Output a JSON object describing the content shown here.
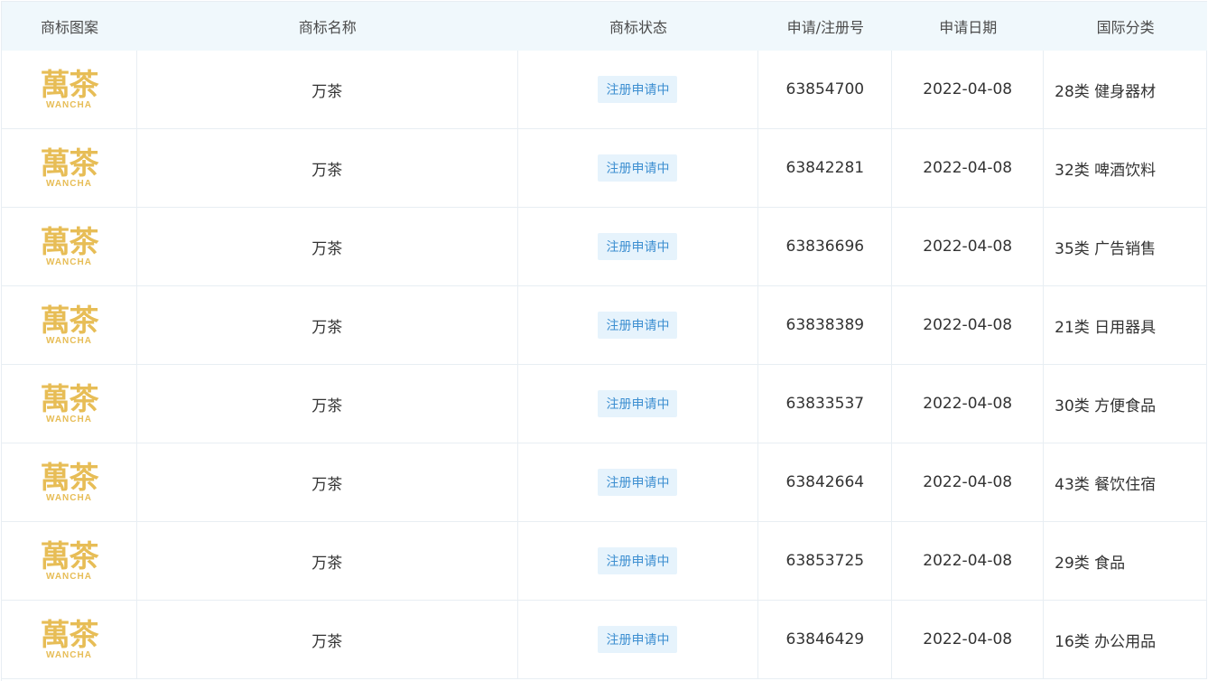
{
  "headers": {
    "logo": "商标图案",
    "name": "商标名称",
    "status": "商标状态",
    "regno": "申请/注册号",
    "date": "申请日期",
    "class": "国际分类"
  },
  "logo": {
    "main": "萬茶",
    "sub": "WANCHA",
    "color": "#e7bd56"
  },
  "colors": {
    "header_bg": "#f0f8fc",
    "badge_bg": "#e6f3fc",
    "badge_text": "#3d8fd1",
    "border": "#e8eef3"
  },
  "rows": [
    {
      "name": "万茶",
      "status": "注册申请中",
      "regno": "63854700",
      "date": "2022-04-08",
      "class": "28类 健身器材"
    },
    {
      "name": "万茶",
      "status": "注册申请中",
      "regno": "63842281",
      "date": "2022-04-08",
      "class": "32类 啤酒饮料"
    },
    {
      "name": "万茶",
      "status": "注册申请中",
      "regno": "63836696",
      "date": "2022-04-08",
      "class": "35类 广告销售"
    },
    {
      "name": "万茶",
      "status": "注册申请中",
      "regno": "63838389",
      "date": "2022-04-08",
      "class": "21类 日用器具"
    },
    {
      "name": "万茶",
      "status": "注册申请中",
      "regno": "63833537",
      "date": "2022-04-08",
      "class": "30类 方便食品"
    },
    {
      "name": "万茶",
      "status": "注册申请中",
      "regno": "63842664",
      "date": "2022-04-08",
      "class": "43类 餐饮住宿"
    },
    {
      "name": "万茶",
      "status": "注册申请中",
      "regno": "63853725",
      "date": "2022-04-08",
      "class": "29类 食品"
    },
    {
      "name": "万茶",
      "status": "注册申请中",
      "regno": "63846429",
      "date": "2022-04-08",
      "class": "16类 办公用品"
    }
  ]
}
